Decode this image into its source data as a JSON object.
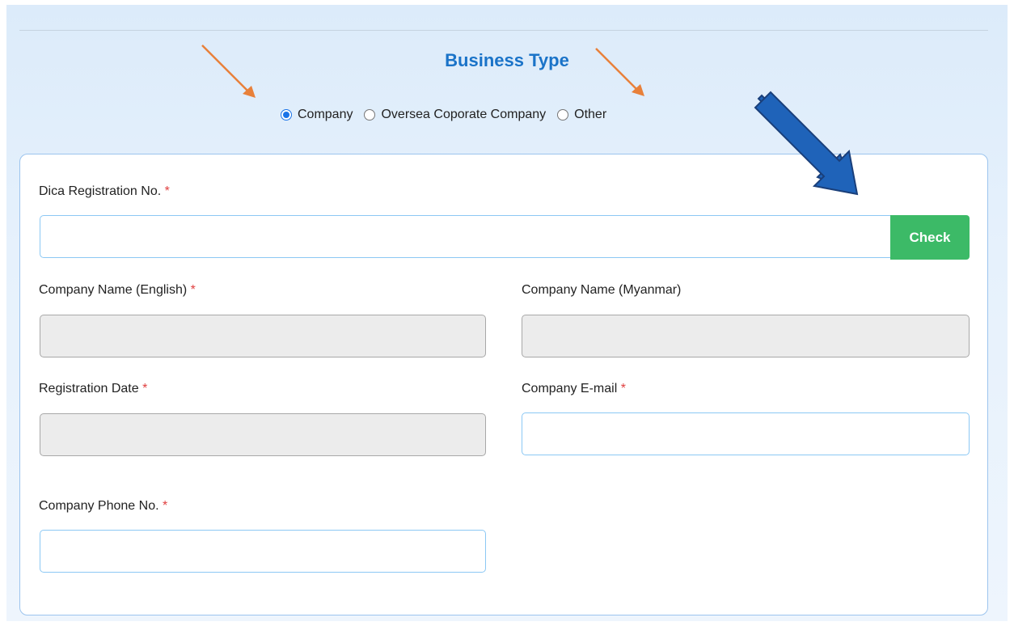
{
  "section": {
    "title": "Business Type"
  },
  "business_type": {
    "options": [
      "Company",
      "Oversea Coporate Company",
      "Other"
    ],
    "selected": "Company"
  },
  "form": {
    "required_mark": "*",
    "dica_label": "Dica Registration No.",
    "dica_value": "",
    "check_button": "Check",
    "name_en_label": "Company Name (English)",
    "name_mm_label": "Company Name (Myanmar)",
    "reg_date_label": "Registration Date",
    "email_label": "Company E-mail",
    "phone_label": "Company Phone No."
  },
  "colors": {
    "title": "#1a73c8",
    "check_button": "#3cba67",
    "annotation_orange": "#e8803a",
    "annotation_blue": "#1e5fb4"
  }
}
